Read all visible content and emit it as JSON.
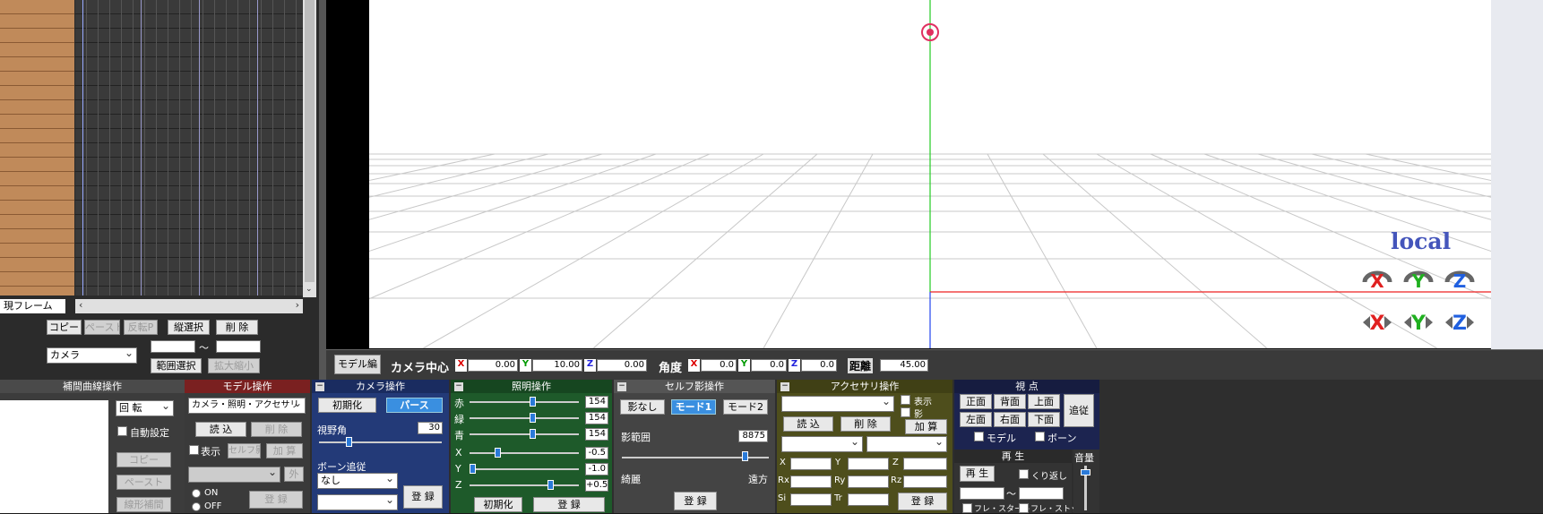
{
  "timeline": {
    "current_frame_label": "現フレーム",
    "copy": "コピー",
    "paste": "ペースト",
    "reverse_paste": "反転P",
    "vertical_select": "縦選択",
    "delete": "削 除",
    "target_select": "カメラ",
    "range_select": "範囲選択",
    "scale": "拡大縮小",
    "range_sep": "～"
  },
  "viewport": {
    "local_label": "local",
    "model_edit_tab": "モデル編",
    "camera_center_label": "カメラ中心",
    "center_x": "0.00",
    "center_y": "10.00",
    "center_z": "0.00",
    "angle_label": "角度",
    "angle_x": "0.0",
    "angle_y": "0.0",
    "angle_z": "0.0",
    "distance_label": "距離",
    "distance": "45.00",
    "axis_x": "X",
    "axis_y": "Y",
    "axis_z": "Z"
  },
  "curve_panel": {
    "title": "補間曲線操作",
    "rotate_select": "回 転",
    "auto_setting": "自動設定",
    "copy": "コピー",
    "paste": "ペースト",
    "linear": "線形補間"
  },
  "model_panel": {
    "title": "モデル操作",
    "target_select": "カメラ・照明・アクセサリ",
    "load": "読 込",
    "delete": "削 除",
    "display": "表示",
    "self_shadow": "セルフ影",
    "add": "加 算",
    "outside": "外",
    "on": "ON",
    "off": "OFF",
    "register": "登 録"
  },
  "camera_panel": {
    "title": "カメラ操作",
    "init": "初期化",
    "perspective": "パース",
    "fov_label": "視野角",
    "fov_value": "30",
    "fov": 30,
    "bone_follow": "ボーン追従",
    "bone_select": "なし",
    "register": "登 録"
  },
  "lighting_panel": {
    "title": "照明操作",
    "red_label": "赤",
    "green_label": "緑",
    "blue_label": "青",
    "red": "154",
    "green": "154",
    "blue": "154",
    "x_label": "X",
    "y_label": "Y",
    "z_label": "Z",
    "x": "-0.5",
    "y": "-1.0",
    "z": "+0.5",
    "init": "初期化",
    "register": "登 録"
  },
  "shadow_panel": {
    "title": "セルフ影操作",
    "none": "影なし",
    "mode1": "モード1",
    "mode2": "モード2",
    "range_label": "影範囲",
    "range_value": "8875",
    "near": "綺麗",
    "far": "遠方",
    "register": "登 録"
  },
  "accessory_panel": {
    "title": "アクセサリ操作",
    "display": "表示",
    "shadow": "影",
    "load": "読 込",
    "delete": "削 除",
    "add": "加 算",
    "x": "X",
    "y": "Y",
    "z": "Z",
    "rx": "Rx",
    "ry": "Ry",
    "rz": "Rz",
    "si": "Si",
    "tr": "Tr",
    "register": "登 録"
  },
  "view_panel": {
    "title": "視 点",
    "front": "正面",
    "back": "背面",
    "top": "上面",
    "left": "左面",
    "right": "右面",
    "bottom": "下面",
    "follow": "追従",
    "model": "モデル",
    "bone": "ボーン"
  },
  "play_panel": {
    "title": "再 生",
    "play": "再 生",
    "repeat": "くり返し",
    "range_sep": "～",
    "frame_start": "フレ・スタート",
    "frame_stop": "フレ・ストップ",
    "volume": "音量"
  },
  "colors": {
    "timeline_bg": "#2b2b2b",
    "bone_list": "#c08a5a",
    "camera_panel": "#233a78",
    "lighting_panel": "#1e5a2a",
    "model_panel": "#7a2020",
    "shadow_panel": "#444444",
    "accessory_panel": "#4e4e1c",
    "view_panel": "#1c2450"
  }
}
